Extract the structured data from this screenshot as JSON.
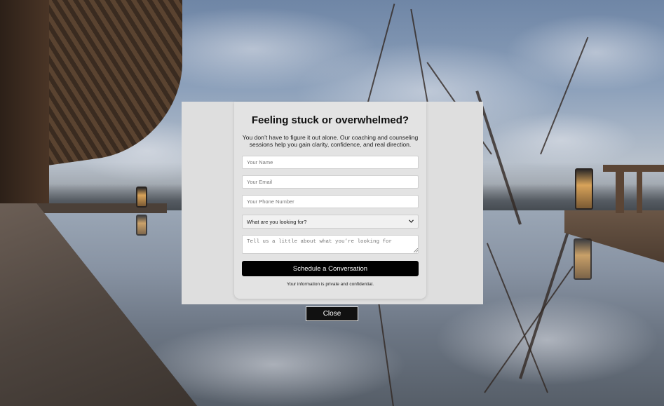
{
  "form": {
    "title": "Feeling stuck or overwhelmed?",
    "subtitle": "You don’t have to figure it out alone. Our coaching and counseling sessions help you gain clarity, confidence, and real direction.",
    "name_placeholder": "Your Name",
    "email_placeholder": "Your Email",
    "phone_placeholder": "Your Phone Number",
    "select_value": "What are you looking for?",
    "message_placeholder": "Tell us a little about what you’re looking for",
    "submit_label": "Schedule a Conversation",
    "privacy_note": "Your information is private and confidential."
  },
  "modal": {
    "close_label": "Close"
  },
  "icons": {
    "select_chevron": "chevron-down-icon"
  }
}
